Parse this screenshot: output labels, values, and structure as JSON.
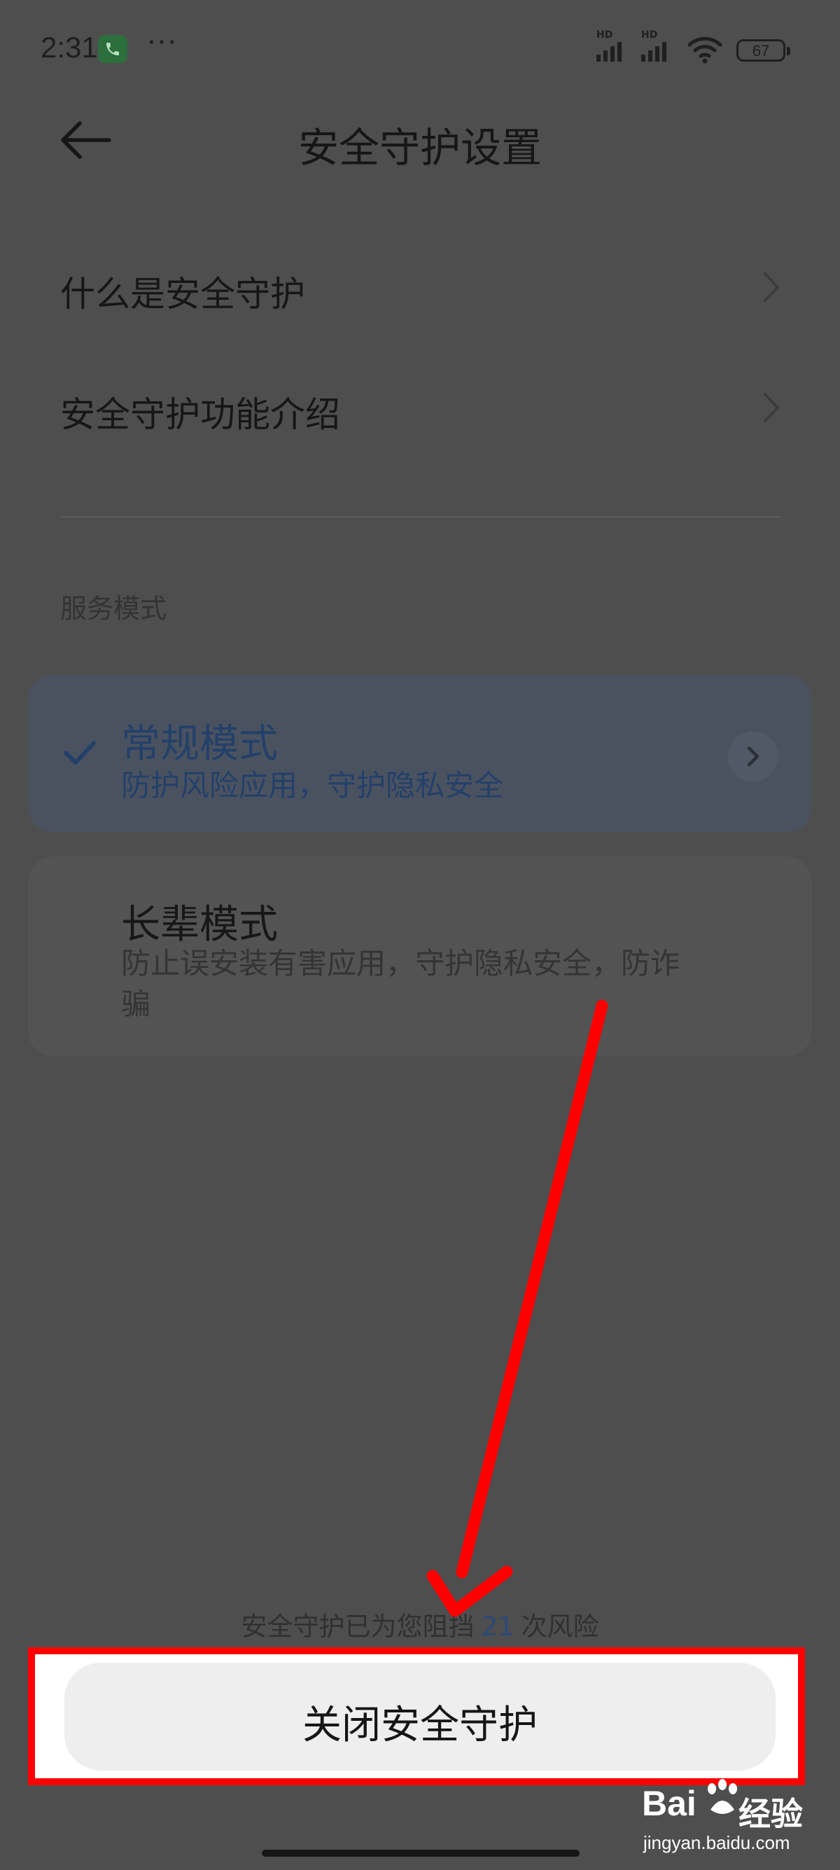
{
  "status_bar": {
    "time": "2:31",
    "call_icon": "phone-icon",
    "more": "···",
    "signal_1_label": "HD",
    "signal_2_label": "HD",
    "battery": "67"
  },
  "header": {
    "back_icon": "arrow-left-icon",
    "title": "安全守护设置"
  },
  "links": [
    {
      "label": "什么是安全守护",
      "icon": "chevron-right-icon"
    },
    {
      "label": "安全守护功能介绍",
      "icon": "chevron-right-icon"
    }
  ],
  "section": {
    "label": "服务模式"
  },
  "modes": [
    {
      "title": "常规模式",
      "description": "防护风险应用，守护隐私安全",
      "selected": true
    },
    {
      "title": "长辈模式",
      "description": "防止误安装有害应用，守护隐私安全，防诈骗",
      "selected": false
    }
  ],
  "footer": {
    "blocked_prefix": "安全守护已为您阻挡",
    "blocked_count": "21",
    "blocked_suffix": "次风险",
    "close_button": "关闭安全守护"
  },
  "annotation": {
    "color": "#ff0000"
  },
  "watermark": {
    "logo": "Bai",
    "logo_cn": "经验",
    "url": "jingyan.baidu.com"
  },
  "colors": {
    "background": "#4e4e4e",
    "accent_blue": "#23406a",
    "selected_card": "#4a5260"
  }
}
